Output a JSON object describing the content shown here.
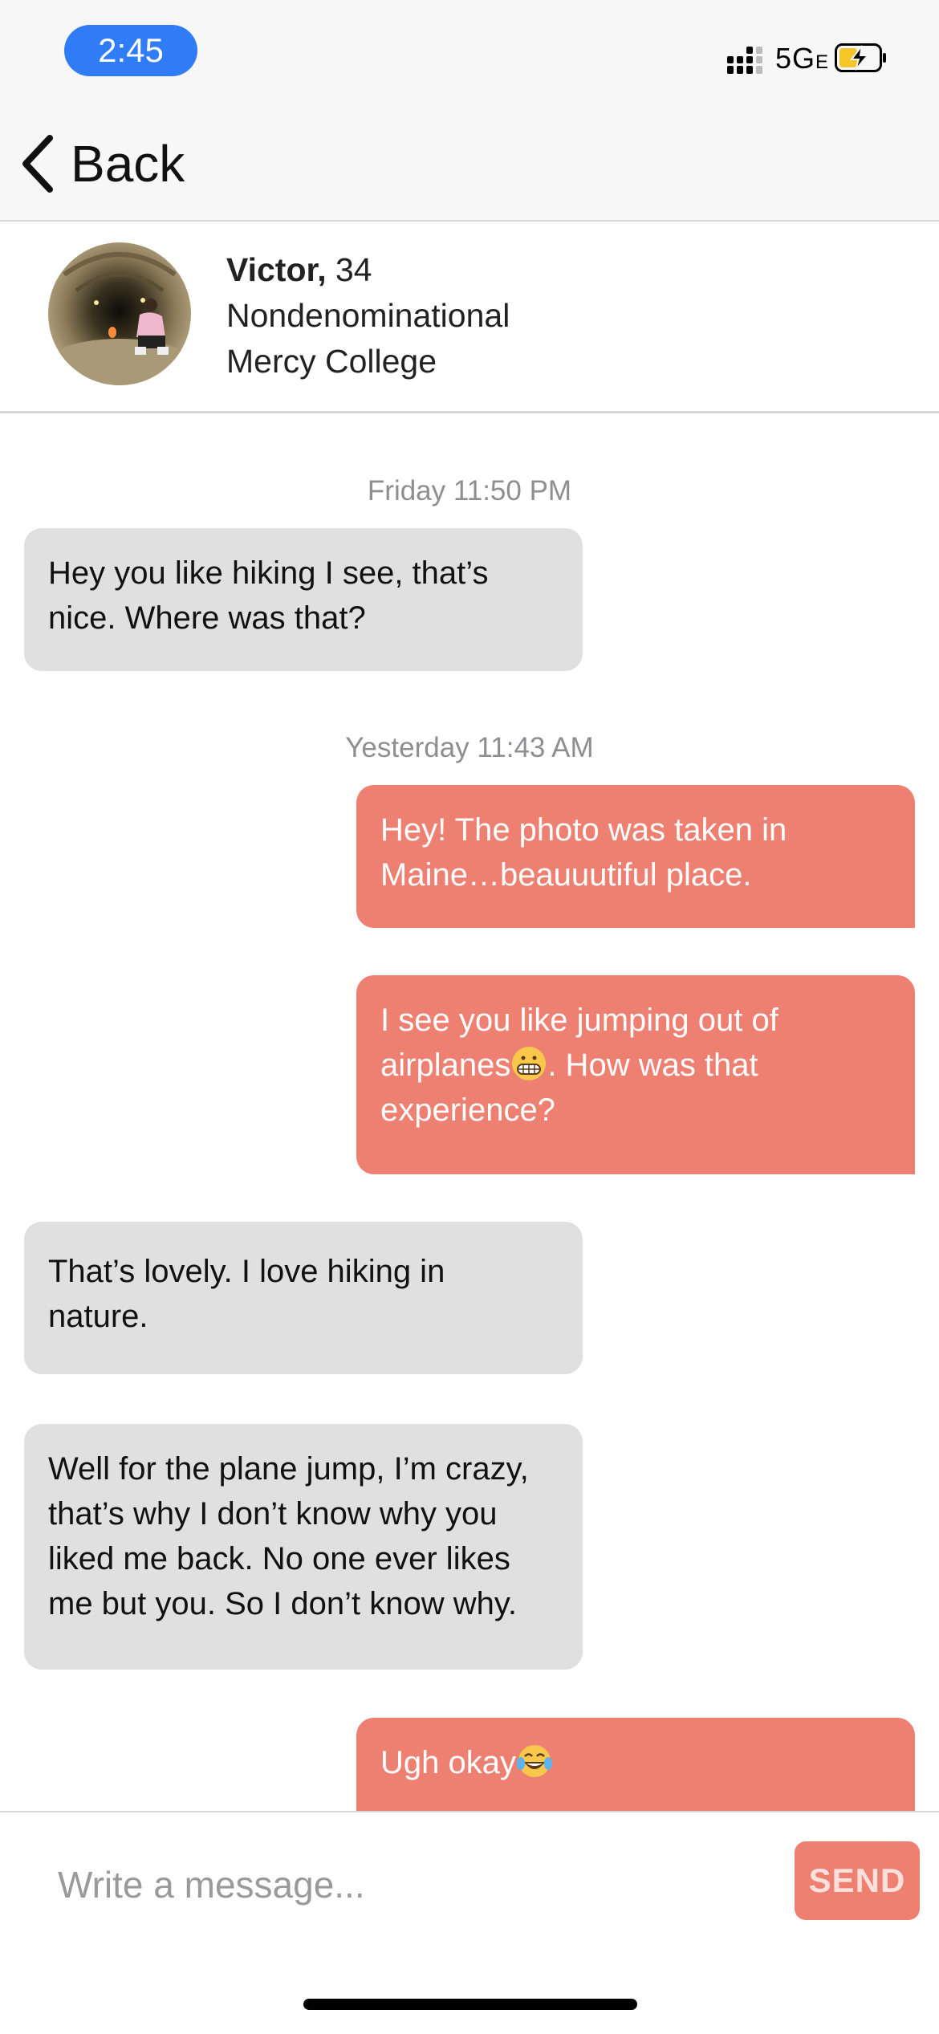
{
  "status_bar": {
    "time": "2:45",
    "network": "5G",
    "network_suffix": "E",
    "battery_state": "charging",
    "colors": {
      "time_pill": "#2f7cf6",
      "battery_fill": "#f5c629"
    }
  },
  "nav": {
    "back_label": "Back",
    "back_icon": "chevron-left-icon"
  },
  "profile": {
    "name": "Victor,",
    "age": "34",
    "religion": "Nondenominational",
    "school": "Mercy College"
  },
  "conversation": {
    "timestamps": [
      "Friday 11:50 PM",
      "Yesterday 11:43 AM"
    ],
    "messages": [
      {
        "from": "them",
        "text": "Hey you like hiking I see, that’s nice. Where was that?"
      },
      {
        "from": "me",
        "text": "Hey! The photo was taken in Maine…beauuutiful place."
      },
      {
        "from": "me",
        "text_before": "I see you like jumping out of airplanes",
        "emoji": "grimacing-face-emoji",
        "text_after": ". How was that experience?"
      },
      {
        "from": "them",
        "text": "That’s lovely. I love hiking in nature."
      },
      {
        "from": "them",
        "text": "Well for the plane jump, I’m crazy, that’s why I don’t know why you liked me back. No one ever likes me but you. So I don’t know why."
      },
      {
        "from": "me",
        "text": "Ugh okay",
        "emoji": "tears-of-joy-emoji"
      }
    ],
    "colors": {
      "incoming": "#e0e0e0",
      "outgoing": "#ee8072"
    }
  },
  "composer": {
    "placeholder": "Write a message...",
    "send_label": "SEND"
  }
}
